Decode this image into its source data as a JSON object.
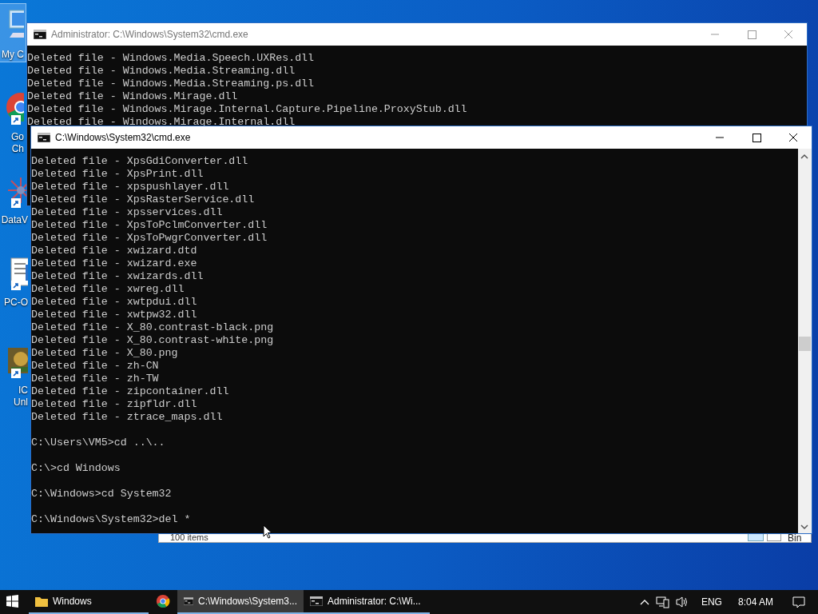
{
  "desktop_icons": [
    {
      "kind": "computer",
      "label": [
        "My C"
      ],
      "selected": true
    },
    {
      "kind": "chrome",
      "label": [
        "Go",
        "Ch"
      ],
      "selected": false
    },
    {
      "kind": "network",
      "label": [
        "DataV"
      ],
      "selected": false
    },
    {
      "kind": "document",
      "label": [
        "PC-O"
      ],
      "selected": false
    },
    {
      "kind": "game",
      "label": [
        "IC",
        "Unl"
      ],
      "selected": false
    }
  ],
  "explorer_behind": {
    "status": "100 items",
    "desktop_label": "Bin"
  },
  "background_window": {
    "title": "Administrator:  C:\\Windows\\System32\\cmd.exe",
    "active": false,
    "lines": [
      "Deleted file - Windows.Media.Speech.UXRes.dll",
      "Deleted file - Windows.Media.Streaming.dll",
      "Deleted file - Windows.Media.Streaming.ps.dll",
      "Deleted file - Windows.Mirage.dll",
      "Deleted file - Windows.Mirage.Internal.Capture.Pipeline.ProxyStub.dll",
      "Deleted file - Windows.Mirage.Internal.dll"
    ]
  },
  "cmd_window": {
    "title": "C:\\Windows\\System32\\cmd.exe",
    "active": true,
    "lines": [
      "Deleted file - XpsGdiConverter.dll",
      "Deleted file - XpsPrint.dll",
      "Deleted file - xpspushlayer.dll",
      "Deleted file - XpsRasterService.dll",
      "Deleted file - xpsservices.dll",
      "Deleted file - XpsToPclmConverter.dll",
      "Deleted file - XpsToPwgrConverter.dll",
      "Deleted file - xwizard.dtd",
      "Deleted file - xwizard.exe",
      "Deleted file - xwizards.dll",
      "Deleted file - xwreg.dll",
      "Deleted file - xwtpdui.dll",
      "Deleted file - xwtpw32.dll",
      "Deleted file - X_80.contrast-black.png",
      "Deleted file - X_80.contrast-white.png",
      "Deleted file - X_80.png",
      "Deleted file - zh-CN",
      "Deleted file - zh-TW",
      "Deleted file - zipcontainer.dll",
      "Deleted file - zipfldr.dll",
      "Deleted file - ztrace_maps.dll"
    ],
    "commands": [
      "C:\\Users\\VM5>cd ..\\..",
      "C:\\>cd Windows",
      "C:\\Windows>cd System32",
      "C:\\Windows\\System32>del *"
    ]
  },
  "taskbar": {
    "items": [
      {
        "kind": "folder",
        "label": "Windows",
        "active": false
      },
      {
        "kind": "chrome",
        "active": false
      },
      {
        "kind": "cmd",
        "label": "C:\\Windows\\System3...",
        "active": true
      },
      {
        "kind": "cmd",
        "label": "Administrator:  C:\\Wi...",
        "active": false
      }
    ],
    "language": "ENG",
    "time": "8:04 AM"
  }
}
